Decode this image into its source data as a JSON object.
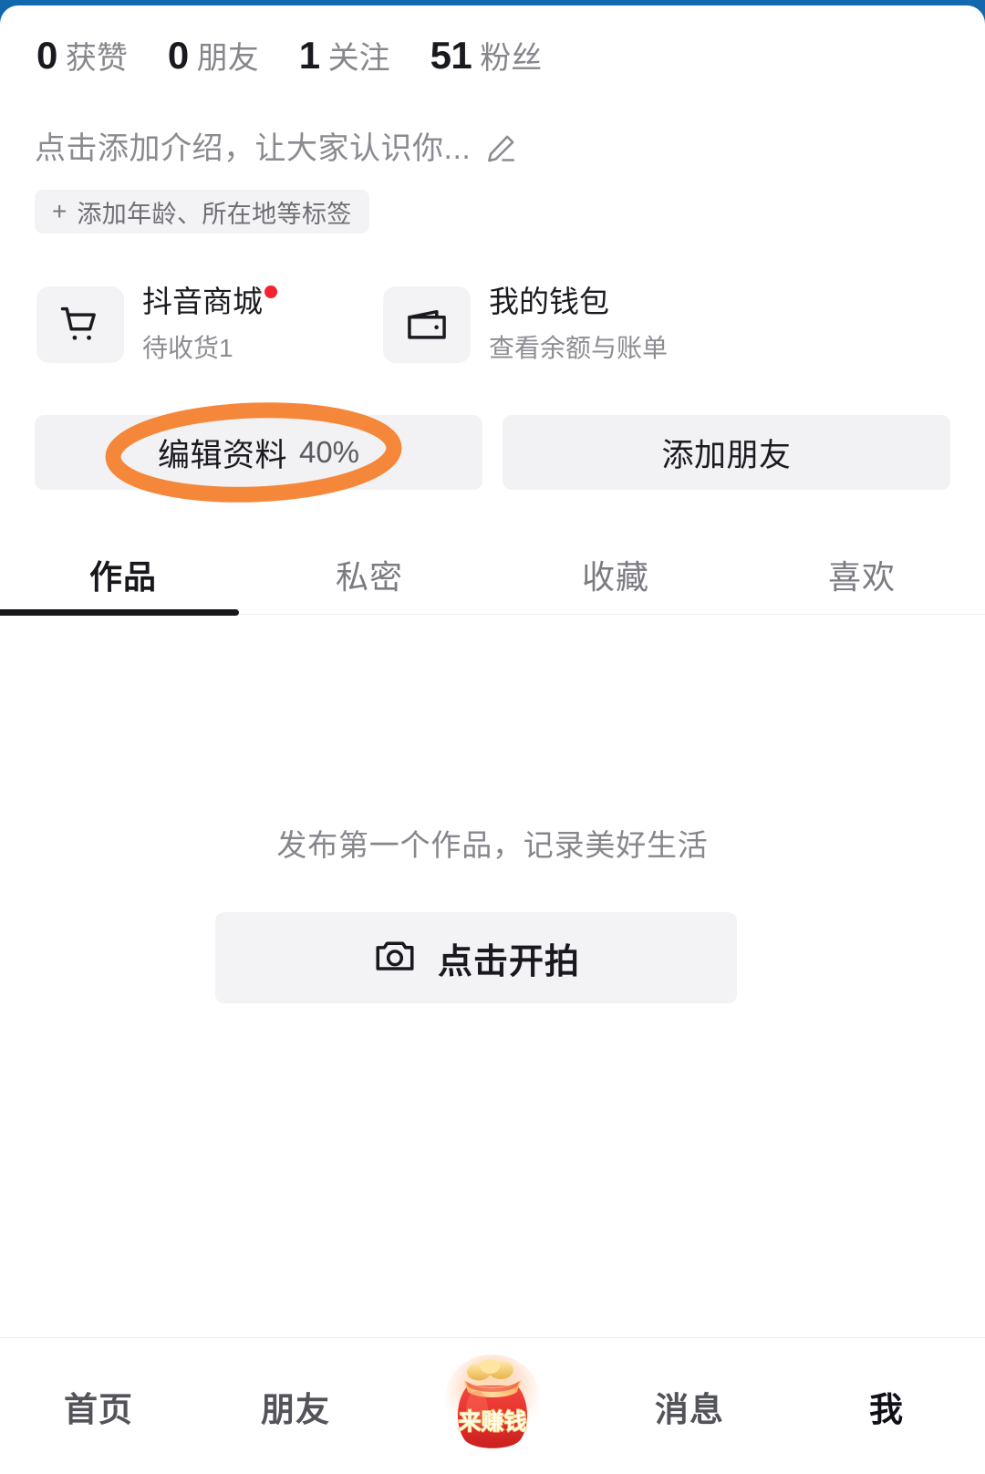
{
  "profile": {
    "stats": [
      {
        "value": "0",
        "label": "获赞"
      },
      {
        "value": "0",
        "label": "朋友"
      },
      {
        "value": "1",
        "label": "关注"
      },
      {
        "value": "51",
        "label": "粉丝"
      }
    ],
    "bio_placeholder": "点击添加介绍，让大家认识你...",
    "edit_bio_icon": "pencil-icon",
    "tag_plus": "+",
    "tag_label": "添加年龄、所在地等标签"
  },
  "entries": [
    {
      "icon": "shopping-cart-icon",
      "title": "抖音商城",
      "subtitle": "待收货1",
      "has_badge": true
    },
    {
      "icon": "wallet-icon",
      "title": "我的钱包",
      "subtitle": "查看余额与账单",
      "has_badge": false
    }
  ],
  "actions": {
    "edit_profile_label": "编辑资料",
    "edit_profile_percent": "40%",
    "add_friend_label": "添加朋友"
  },
  "annotation": {
    "shape": "ellipse-highlight",
    "color": "#F5873A",
    "target": "编辑资料 40%"
  },
  "tabs": [
    {
      "label": "作品",
      "active": true
    },
    {
      "label": "私密",
      "active": false
    },
    {
      "label": "收藏",
      "active": false
    },
    {
      "label": "喜欢",
      "active": false
    }
  ],
  "empty_state": {
    "hint": "发布第一个作品，记录美好生活",
    "button_label": "点击开拍",
    "button_icon": "camera-icon"
  },
  "bottom_nav": [
    {
      "label": "首页",
      "icon": "home-text",
      "active": false
    },
    {
      "label": "朋友",
      "icon": "friends-text",
      "active": false
    },
    {
      "label": "来赚钱",
      "icon": "moneybag-icon",
      "active": false
    },
    {
      "label": "消息",
      "icon": "messages-text",
      "active": false
    },
    {
      "label": "我",
      "icon": "profile-text",
      "active": true
    }
  ],
  "colors": {
    "accent_orange": "#F5873A",
    "badge_red": "#F5232F",
    "text_primary": "#1A1A20",
    "text_secondary": "#86868C",
    "surface": "#F3F3F5",
    "frame_blue": "#1268AD"
  }
}
